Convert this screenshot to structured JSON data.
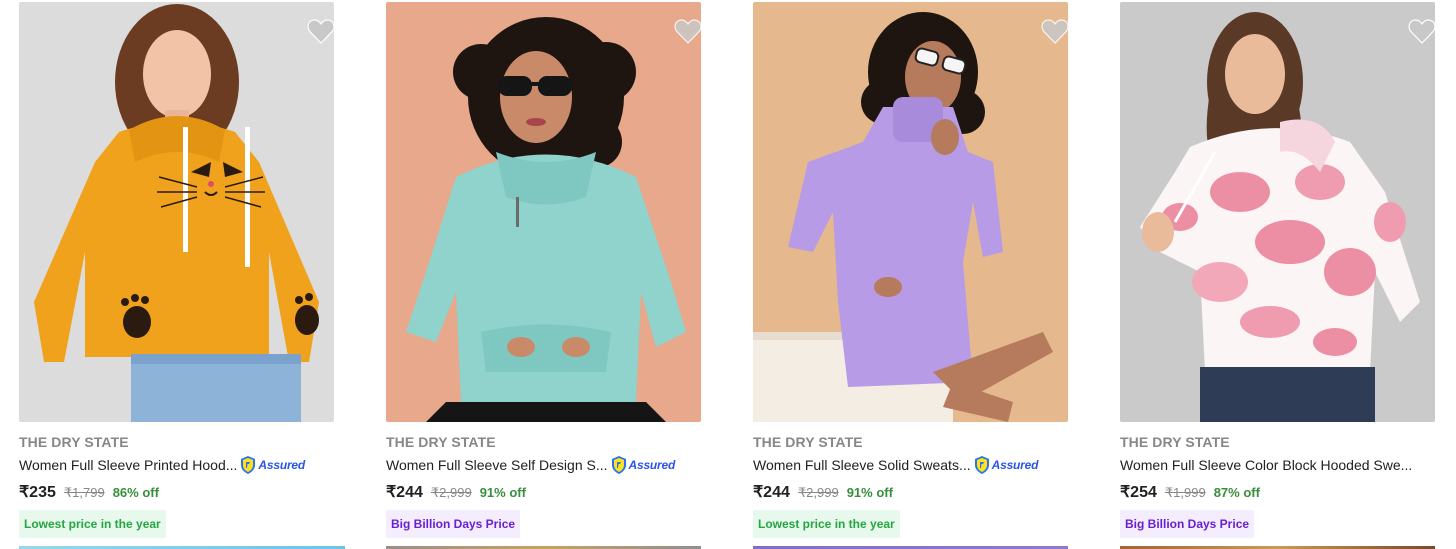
{
  "products": [
    {
      "brand": "THE DRY STATE",
      "title": "Women Full Sleeve Printed Hood...",
      "assured_label": "Assured",
      "price": "₹235",
      "mrp": "₹1,799",
      "discount": "86% off",
      "badge": "Lowest price in the year",
      "badge_style": "green",
      "image_desc": "orange-cat-hoodie",
      "colors": {
        "bg": "#d9d9d9",
        "garment": "#f0a21c",
        "accent": "#6b9ad1"
      }
    },
    {
      "brand": "THE DRY STATE",
      "title": "Women Full Sleeve Self Design S...",
      "assured_label": "Assured",
      "price": "₹244",
      "mrp": "₹2,999",
      "discount": "91% off",
      "badge": "Big Billion Days Price",
      "badge_style": "purple",
      "image_desc": "mint-fleece-sweatshirt",
      "colors": {
        "bg": "#e9a98e",
        "garment": "#8fd3cc",
        "accent": "#1a1a1a"
      }
    },
    {
      "brand": "THE DRY STATE",
      "title": "Women Full Sleeve Solid Sweats...",
      "assured_label": "Assured",
      "price": "₹244",
      "mrp": "₹2,999",
      "discount": "91% off",
      "badge": "Lowest price in the year",
      "badge_style": "green",
      "image_desc": "lavender-fleece-dress",
      "colors": {
        "bg": "#e7b98e",
        "garment": "#b79be6",
        "accent": "#f3ede4"
      }
    },
    {
      "brand": "THE DRY STATE",
      "title": "Women Full Sleeve Color Block Hooded Swe...",
      "assured_label": "",
      "price": "₹254",
      "mrp": "₹1,999",
      "discount": "87% off",
      "badge": "Big Billion Days Price",
      "badge_style": "purple",
      "image_desc": "pink-tie-dye-hoodie",
      "colors": {
        "bg": "#c9c9c9",
        "garment": "#f4c4cf",
        "accent": "#2f3c56"
      }
    }
  ],
  "theme": {
    "brand_color": "#878787",
    "discount_color": "#388e3c",
    "assured_color": "#2a55e5",
    "wishlist_icon_color": "#c2c2c2"
  }
}
